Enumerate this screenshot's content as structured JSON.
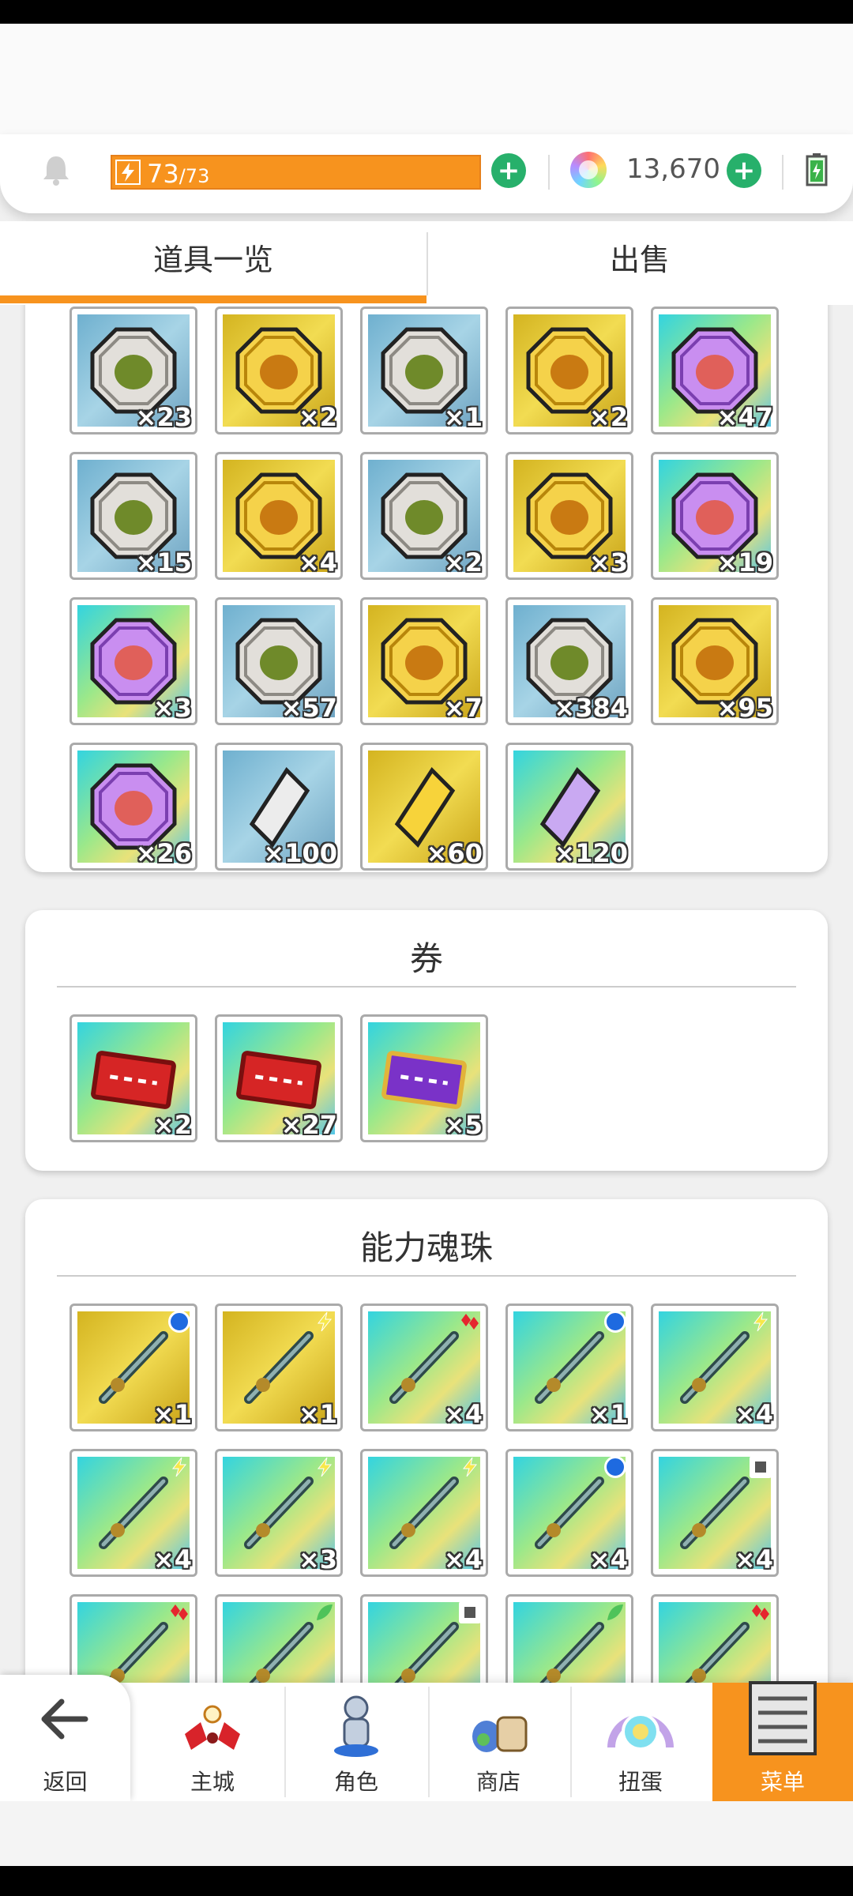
{
  "hud": {
    "energy_current": "73",
    "energy_max": "/73",
    "gems": "13,670"
  },
  "tabs": [
    {
      "label": "道具一览",
      "active": true
    },
    {
      "label": "出售",
      "active": false
    }
  ],
  "sections": [
    {
      "title": "",
      "items": [
        {
          "bg": "blue",
          "icon": "slime-silver-medal-icon",
          "qty": "×23"
        },
        {
          "bg": "gold",
          "icon": "horned-gold-medal-icon",
          "qty": "×2"
        },
        {
          "bg": "blue",
          "icon": "tree-silver-medal-icon",
          "qty": "×1"
        },
        {
          "bg": "gold",
          "icon": "tree-gold-medal-icon",
          "qty": "×2"
        },
        {
          "bg": "rainbow",
          "icon": "tree-purple-medal-icon",
          "qty": "×47"
        },
        {
          "bg": "blue",
          "icon": "bird-silver-medal-icon",
          "qty": "×15"
        },
        {
          "bg": "gold",
          "icon": "bird-gold-medal-icon",
          "qty": "×4"
        },
        {
          "bg": "blue",
          "icon": "skull-silver-medal-icon",
          "qty": "×2"
        },
        {
          "bg": "gold",
          "icon": "skull-gold-medal-icon",
          "qty": "×3"
        },
        {
          "bg": "rainbow",
          "icon": "skull-purple-medal-icon",
          "qty": "×19"
        },
        {
          "bg": "rainbow",
          "icon": "ghost-purple-medal-icon",
          "qty": "×3"
        },
        {
          "bg": "blue",
          "icon": "beast-silver-medal-icon",
          "qty": "×57"
        },
        {
          "bg": "gold",
          "icon": "beast-gold-medal-icon",
          "qty": "×7"
        },
        {
          "bg": "blue",
          "icon": "dome-silver-medal-icon",
          "qty": "×384"
        },
        {
          "bg": "gold",
          "icon": "dome-gold-medal-icon",
          "qty": "×95"
        },
        {
          "bg": "rainbow",
          "icon": "dome-purple-medal-icon",
          "qty": "×26"
        },
        {
          "bg": "blue",
          "icon": "silver-crystal-icon",
          "qty": "×100"
        },
        {
          "bg": "gold",
          "icon": "gold-crystal-icon",
          "qty": "×60"
        },
        {
          "bg": "rainbow",
          "icon": "purple-crystal-icon",
          "qty": "×120"
        }
      ]
    },
    {
      "title": "券",
      "items": [
        {
          "bg": "rainbow",
          "icon": "red-ticket-stack-icon",
          "qty": "×2"
        },
        {
          "bg": "rainbow",
          "icon": "red-ticket-icon",
          "qty": "×27"
        },
        {
          "bg": "rainbow",
          "icon": "purple-ticket-icon",
          "qty": "×5"
        }
      ]
    },
    {
      "title": "能力魂珠",
      "items": [
        {
          "bg": "gold",
          "icon": "pickaxe-icon",
          "badge": "circle",
          "qty": "×1"
        },
        {
          "bg": "gold",
          "icon": "turtle-shell-icon",
          "badge": "bolt",
          "qty": "×1"
        },
        {
          "bg": "rainbow",
          "icon": "sword-icon",
          "badge": "gems",
          "qty": "×4"
        },
        {
          "bg": "rainbow",
          "icon": "blade-icon",
          "badge": "circle",
          "qty": "×1"
        },
        {
          "bg": "rainbow",
          "icon": "halberd-icon",
          "badge": "bolt",
          "qty": "×4"
        },
        {
          "bg": "rainbow",
          "icon": "axe-icon",
          "badge": "bolt",
          "qty": "×4"
        },
        {
          "bg": "rainbow",
          "icon": "hammer-icon",
          "badge": "bolt",
          "qty": "×3"
        },
        {
          "bg": "rainbow",
          "icon": "spear-icon",
          "badge": "bolt",
          "qty": "×4"
        },
        {
          "bg": "rainbow",
          "icon": "trident-icon",
          "badge": "circle",
          "qty": "×4"
        },
        {
          "bg": "rainbow",
          "icon": "golden-spear-icon",
          "badge": "square",
          "qty": "×4"
        },
        {
          "bg": "rainbow",
          "icon": "bow-icon",
          "badge": "gems",
          "qty": ""
        },
        {
          "bg": "rainbow",
          "icon": "green-book-icon",
          "badge": "leaf",
          "qty": ""
        },
        {
          "bg": "rainbow",
          "icon": "fan-icon",
          "badge": "square",
          "qty": ""
        },
        {
          "bg": "rainbow",
          "icon": "dark-axe-icon",
          "badge": "leaf",
          "qty": ""
        },
        {
          "bg": "rainbow",
          "icon": "mask-icon",
          "badge": "gems",
          "qty": ""
        }
      ]
    }
  ],
  "nav": [
    {
      "label": "返回",
      "icon": "arrow-left-icon"
    },
    {
      "label": "主城",
      "icon": "castle-icon"
    },
    {
      "label": "角色",
      "icon": "character-icon"
    },
    {
      "label": "商店",
      "icon": "shop-icon"
    },
    {
      "label": "扭蛋",
      "icon": "gacha-icon"
    },
    {
      "label": "菜单",
      "icon": "menu-icon",
      "active": true
    }
  ],
  "colors": {
    "accent": "#f7931e",
    "plus": "#27b06b",
    "badge_blue": "#1e6ae0"
  }
}
